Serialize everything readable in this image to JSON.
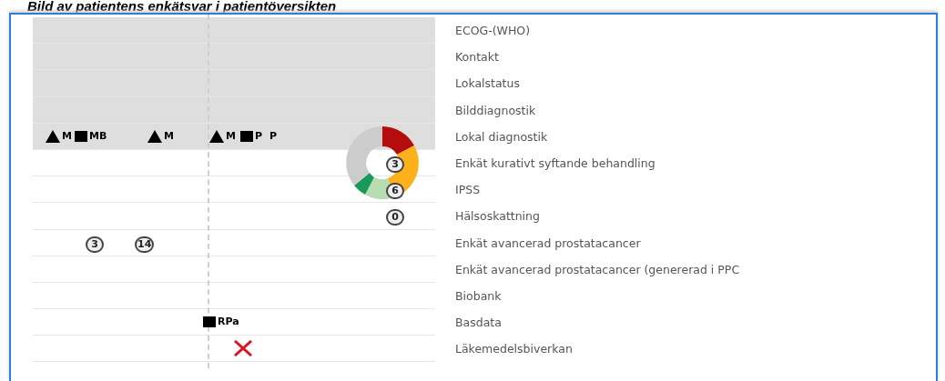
{
  "title": "Bild av patientens enkätsvar i patientöversikten",
  "rows": [
    {
      "label": "ECOG-(WHO)",
      "shaded": true,
      "markers": []
    },
    {
      "label": "Kontakt",
      "shaded": true,
      "markers": []
    },
    {
      "label": "Lokalstatus",
      "shaded": true,
      "markers": []
    },
    {
      "label": "Bilddiagnostik",
      "shaded": true,
      "markers": []
    },
    {
      "label": "Lokal diagnostik",
      "shaded": true,
      "markers": [
        {
          "kind": "triangle",
          "text": "M"
        },
        {
          "kind": "bar",
          "text": "MB"
        },
        {
          "kind": "triangle",
          "text": "M"
        },
        {
          "kind": "triangle",
          "text": "M"
        },
        {
          "kind": "bar",
          "text": "P"
        },
        {
          "kind": "plain",
          "text": "P"
        }
      ]
    },
    {
      "label": "Enkät kurativt syftande behandling",
      "shaded": false,
      "markers": [
        {
          "kind": "donut"
        },
        {
          "kind": "circle",
          "text": "3"
        }
      ]
    },
    {
      "label": "IPSS",
      "shaded": false,
      "markers": [
        {
          "kind": "circle",
          "text": "6"
        }
      ]
    },
    {
      "label": "Hälsoskattning",
      "shaded": false,
      "markers": [
        {
          "kind": "circle",
          "text": "0"
        }
      ]
    },
    {
      "label": "Enkät avancerad prostatacancer",
      "shaded": false,
      "markers": [
        {
          "kind": "circle",
          "text": "3"
        },
        {
          "kind": "circle",
          "text": "14"
        }
      ]
    },
    {
      "label": "Enkät avancerad prostatacancer (genererad i PPC",
      "shaded": false,
      "markers": []
    },
    {
      "label": "Biobank",
      "shaded": false,
      "markers": []
    },
    {
      "label": "Basdata",
      "shaded": false,
      "markers": [
        {
          "kind": "bar",
          "text": "RPa"
        }
      ]
    },
    {
      "label": "Läkemedelsbiverkan",
      "shaded": false,
      "markers": [
        {
          "kind": "cross"
        }
      ]
    }
  ]
}
